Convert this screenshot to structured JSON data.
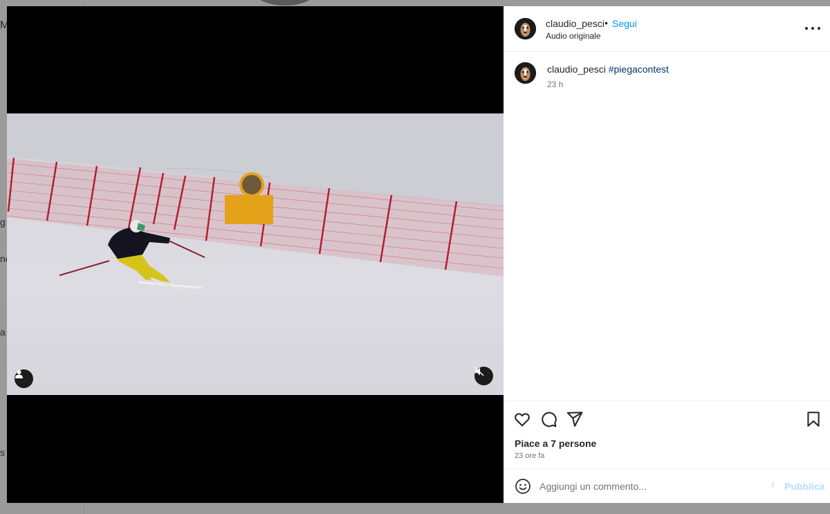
{
  "background": {
    "fragments": [
      "M",
      "g",
      "ne",
      "a",
      "s"
    ]
  },
  "post": {
    "username": "claudio_pesci",
    "separator": "•",
    "follow_label": "Segui",
    "audio_label": "Audio originale",
    "more_icon": "more-horizontal-icon"
  },
  "caption": {
    "username": "claudio_pesci",
    "hashtag": "#piegacontest",
    "time": "23 h"
  },
  "actions": {
    "likes_text": "Piace a 7 persone",
    "time_ago": "23 ore fa",
    "icons": [
      "heart-icon",
      "comment-icon",
      "share-icon",
      "bookmark-icon"
    ]
  },
  "comment": {
    "placeholder": "Aggiungi un commento...",
    "publish_label": "Pubblica"
  },
  "colors": {
    "follow": "#0095f6",
    "hashtag": "#00376b",
    "publish_disabled": "#b2dffc",
    "net": "#c8283c"
  }
}
